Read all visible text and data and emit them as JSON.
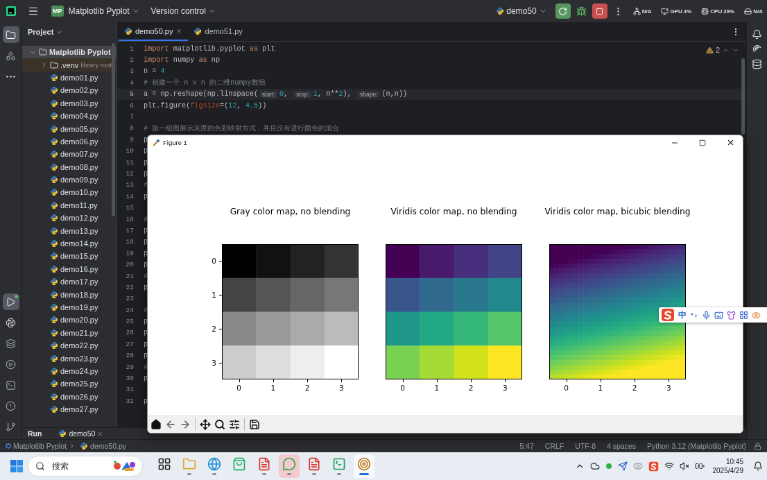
{
  "top_bar": {
    "project_badge": "MP",
    "project": "Matplotlib Pyplot",
    "vcs": "Version control",
    "run_config": "demo50",
    "monitors": [
      {
        "kind": "net",
        "label": "N/A"
      },
      {
        "kind": "gpu",
        "label": "GPU",
        "value": "3%"
      },
      {
        "kind": "cpu",
        "label": "CPU",
        "value": "29%"
      },
      {
        "kind": "disk",
        "label": "N/A"
      }
    ]
  },
  "left_toolbar": {
    "top": [
      {
        "kind": "project",
        "selected": true
      },
      {
        "kind": "structure",
        "selected": false
      },
      {
        "kind": "more",
        "selected": false
      }
    ],
    "bottom": [
      {
        "kind": "run",
        "selected": true
      },
      {
        "kind": "python",
        "selected": false
      },
      {
        "kind": "layers",
        "selected": false
      },
      {
        "kind": "services",
        "selected": false
      },
      {
        "kind": "terminal",
        "selected": false
      },
      {
        "kind": "problems",
        "selected": false
      },
      {
        "kind": "git",
        "selected": false
      }
    ]
  },
  "project_panel": {
    "title": "Project",
    "tree": [
      {
        "name": "Matplotlib Pyplot",
        "kind": "folder",
        "expanded": true,
        "selected": true,
        "children": [
          {
            "name": ".venv",
            "kind": "library",
            "note": "library root",
            "expanded": false,
            "selected": false
          },
          {
            "name": "demo01.py",
            "kind": "python",
            "selected": false
          },
          {
            "name": "demo02.py",
            "kind": "python",
            "selected": false
          },
          {
            "name": "demo03.py",
            "kind": "python",
            "selected": false
          },
          {
            "name": "demo04.py",
            "kind": "python",
            "selected": false
          },
          {
            "name": "demo05.py",
            "kind": "python",
            "selected": false
          },
          {
            "name": "demo06.py",
            "kind": "python",
            "selected": false
          },
          {
            "name": "demo07.py",
            "kind": "python",
            "selected": false
          },
          {
            "name": "demo08.py",
            "kind": "python",
            "selected": false
          },
          {
            "name": "demo09.py",
            "kind": "python",
            "selected": false
          },
          {
            "name": "demo10.py",
            "kind": "python",
            "selected": false
          },
          {
            "name": "demo11.py",
            "kind": "python",
            "selected": false
          },
          {
            "name": "demo12.py",
            "kind": "python",
            "selected": false
          },
          {
            "name": "demo13.py",
            "kind": "python",
            "selected": false
          },
          {
            "name": "demo14.py",
            "kind": "python",
            "selected": false
          },
          {
            "name": "demo15.py",
            "kind": "python",
            "selected": false
          },
          {
            "name": "demo16.py",
            "kind": "python",
            "selected": false
          },
          {
            "name": "demo17.py",
            "kind": "python",
            "selected": false
          },
          {
            "name": "demo18.py",
            "kind": "python",
            "selected": false
          },
          {
            "name": "demo19.py",
            "kind": "python",
            "selected": false
          },
          {
            "name": "demo20.py",
            "kind": "python",
            "selected": false
          },
          {
            "name": "demo21.py",
            "kind": "python",
            "selected": false
          },
          {
            "name": "demo22.py",
            "kind": "python",
            "selected": false
          },
          {
            "name": "demo23.py",
            "kind": "python",
            "selected": false
          },
          {
            "name": "demo24.py",
            "kind": "python",
            "selected": false
          },
          {
            "name": "demo25.py",
            "kind": "python",
            "selected": false
          },
          {
            "name": "demo26.py",
            "kind": "python",
            "selected": false
          },
          {
            "name": "demo27.py",
            "kind": "python",
            "selected": false
          }
        ]
      }
    ]
  },
  "editor": {
    "tabs": [
      {
        "label": "demo50.py",
        "selected": true
      },
      {
        "label": "demo51.py",
        "selected": false
      }
    ],
    "warnings": "2",
    "lines": [
      {
        "number": "1",
        "current": false,
        "tokens": [
          {
            "kind": "keyword",
            "text": "import"
          },
          {
            "kind": "plain",
            "text": " matplotlib.pyplot "
          },
          {
            "kind": "keyword",
            "text": "as"
          },
          {
            "kind": "plain",
            "text": " plt"
          }
        ]
      },
      {
        "number": "2",
        "current": false,
        "tokens": [
          {
            "kind": "keyword",
            "text": "import"
          },
          {
            "kind": "plain",
            "text": " numpy "
          },
          {
            "kind": "keyword",
            "text": "as"
          },
          {
            "kind": "plain",
            "text": " np"
          }
        ]
      },
      {
        "number": "3",
        "current": false,
        "tokens": [
          {
            "kind": "plain",
            "text": "n = "
          },
          {
            "kind": "number",
            "text": "4"
          }
        ]
      },
      {
        "number": "4",
        "current": false,
        "tokens": [
          {
            "kind": "comment",
            "text": "# 创建一个 n x n 的二维numpy数组"
          }
        ]
      },
      {
        "number": "5",
        "current": true,
        "tokens": [
          {
            "kind": "plain",
            "text": "a = np.reshape(np.linspace("
          },
          {
            "kind": "hint",
            "text": "start:"
          },
          {
            "kind": "number",
            "text": "0"
          },
          {
            "kind": "plain",
            "text": ", "
          },
          {
            "kind": "hint",
            "text": "stop:"
          },
          {
            "kind": "number",
            "text": "1"
          },
          {
            "kind": "plain",
            "text": ", n**"
          },
          {
            "kind": "number",
            "text": "2"
          },
          {
            "kind": "plain",
            "text": "), "
          },
          {
            "kind": "hint",
            "text": "shape:"
          },
          {
            "kind": "plain",
            "text": "(n,n))"
          }
        ]
      },
      {
        "number": "6",
        "current": false,
        "tokens": [
          {
            "kind": "plain",
            "text": "plt.figure("
          },
          {
            "kind": "kwarg",
            "text": "figsize"
          },
          {
            "kind": "plain",
            "text": "=("
          },
          {
            "kind": "number",
            "text": "12"
          },
          {
            "kind": "plain",
            "text": ", "
          },
          {
            "kind": "number",
            "text": "4.5"
          },
          {
            "kind": "plain",
            "text": "))"
          }
        ]
      },
      {
        "number": "7",
        "current": false
      },
      {
        "number": "8",
        "current": false,
        "tokens": [
          {
            "kind": "comment",
            "text": "# 第一组图展示灰度的色彩映射方式，并且没有进行颜色的混合"
          }
        ]
      },
      {
        "number": "9",
        "current": false,
        "tokens": [
          {
            "kind": "plain",
            "text": "p"
          }
        ]
      },
      {
        "number": "10",
        "current": false,
        "tokens": [
          {
            "kind": "plain",
            "text": "p"
          }
        ]
      },
      {
        "number": "11",
        "current": false,
        "tokens": [
          {
            "kind": "plain",
            "text": "p"
          }
        ]
      },
      {
        "number": "12",
        "current": false,
        "tokens": [
          {
            "kind": "plain",
            "text": "p"
          }
        ]
      },
      {
        "number": "13",
        "current": false,
        "tokens": [
          {
            "kind": "comment",
            "text": "#"
          }
        ]
      },
      {
        "number": "14",
        "current": false,
        "tokens": [
          {
            "kind": "plain",
            "text": "p"
          }
        ]
      },
      {
        "number": "15",
        "current": false
      },
      {
        "number": "16",
        "current": false,
        "tokens": [
          {
            "kind": "comment",
            "text": "#"
          }
        ]
      },
      {
        "number": "17",
        "current": false,
        "tokens": [
          {
            "kind": "plain",
            "text": "p"
          }
        ]
      },
      {
        "number": "18",
        "current": false,
        "tokens": [
          {
            "kind": "plain",
            "text": "p"
          }
        ]
      },
      {
        "number": "19",
        "current": false,
        "tokens": [
          {
            "kind": "plain",
            "text": "p"
          }
        ]
      },
      {
        "number": "20",
        "current": false,
        "tokens": [
          {
            "kind": "plain",
            "text": "p"
          }
        ]
      },
      {
        "number": "21",
        "current": false,
        "tokens": [
          {
            "kind": "comment",
            "text": "#"
          }
        ]
      },
      {
        "number": "22",
        "current": false,
        "tokens": [
          {
            "kind": "plain",
            "text": "p"
          }
        ]
      },
      {
        "number": "23",
        "current": false
      },
      {
        "number": "24",
        "current": false,
        "tokens": [
          {
            "kind": "comment",
            "text": "#"
          }
        ]
      },
      {
        "number": "25",
        "current": false,
        "tokens": [
          {
            "kind": "plain",
            "text": "p"
          }
        ]
      },
      {
        "number": "26",
        "current": false,
        "tokens": [
          {
            "kind": "plain",
            "text": "p"
          }
        ]
      },
      {
        "number": "27",
        "current": false,
        "tokens": [
          {
            "kind": "plain",
            "text": "p"
          }
        ]
      },
      {
        "number": "28",
        "current": false,
        "tokens": [
          {
            "kind": "plain",
            "text": "p"
          }
        ]
      },
      {
        "number": "29",
        "current": false,
        "tokens": [
          {
            "kind": "comment",
            "text": "#"
          }
        ]
      },
      {
        "number": "30",
        "current": false,
        "tokens": [
          {
            "kind": "plain",
            "text": "p"
          }
        ]
      },
      {
        "number": "31",
        "current": false
      },
      {
        "number": "32",
        "current": false,
        "tokens": [
          {
            "kind": "plain",
            "text": "p"
          }
        ]
      }
    ]
  },
  "run_panel": {
    "title": "Run",
    "tab": "demo50"
  },
  "status_bar": {
    "breadcrumbs": [
      "Matplotlib Pyplot",
      "demo50.py"
    ],
    "items": [
      "5:47",
      "CRLF",
      "UTF-8",
      "4 spaces",
      "Python 3.12 (Matplotlib Pyplot)"
    ]
  },
  "figure_window": {
    "title": "Figure 1",
    "plots": [
      {
        "title": "Gray color map, no blending",
        "kind": "gray",
        "xticks": [
          "0",
          "1",
          "2",
          "3"
        ],
        "yticks": [
          "0",
          "1",
          "2",
          "3"
        ]
      },
      {
        "title": "Viridis color map, no blending",
        "kind": "viridis",
        "xticks": [
          "0",
          "1",
          "2",
          "3"
        ]
      },
      {
        "title": "Viridis color map, bicubic blending",
        "kind": "viridis-bicubic",
        "xticks": [
          "0",
          "1",
          "2",
          "3"
        ]
      }
    ]
  },
  "ime_bar": {
    "mode": "中"
  },
  "taskbar": {
    "search_placeholder": "搜索",
    "apps": [
      {
        "kind": "task-view",
        "running": false,
        "active": false,
        "highlighted": false
      },
      {
        "kind": "files",
        "running": true,
        "active": false,
        "highlighted": false
      },
      {
        "kind": "browser",
        "running": true,
        "active": false,
        "highlighted": false
      },
      {
        "kind": "store",
        "running": false,
        "active": false,
        "highlighted": false
      },
      {
        "kind": "office",
        "running": true,
        "active": false,
        "highlighted": false
      },
      {
        "kind": "chat",
        "running": true,
        "active": false,
        "highlighted": true
      },
      {
        "kind": "office",
        "running": true,
        "active": false,
        "highlighted": false
      },
      {
        "kind": "ide",
        "running": true,
        "active": false,
        "highlighted": false
      },
      {
        "kind": "figure",
        "running": true,
        "active": true,
        "highlighted": false
      }
    ],
    "time": "10:45",
    "date": "2025/4/29"
  }
}
